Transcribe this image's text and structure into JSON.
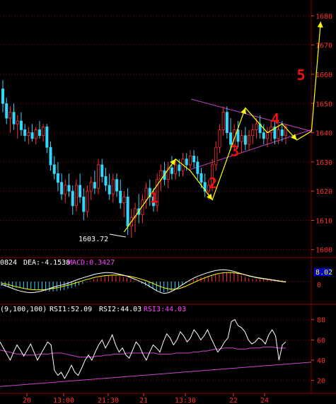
{
  "chart_data": {
    "type": "candlestick",
    "main_panel": {
      "y_ticks": [
        "1680",
        "1670",
        "1660",
        "1650",
        "1640",
        "1630",
        "1620",
        "1610",
        "1600"
      ],
      "ylim": [
        1598,
        1683
      ],
      "grid": true,
      "low_annotation": "1603.72",
      "wave_labels": [
        "1",
        "2",
        "3",
        "4",
        "5"
      ],
      "colors": {
        "up": "#ff3030",
        "down": "#30d8ff",
        "grid": "#8b0000",
        "axis_text": "#ff3030",
        "trend": "#cc44cc",
        "projection": "#ffff00",
        "wave_label": "#ee1111"
      },
      "candles": [
        [
          1655,
          1658,
          1647,
          1650
        ],
        [
          1650,
          1652,
          1643,
          1645
        ],
        [
          1645,
          1649,
          1640,
          1647
        ],
        [
          1647,
          1650,
          1641,
          1643
        ],
        [
          1643,
          1646,
          1638,
          1644
        ],
        [
          1644,
          1647,
          1639,
          1641
        ],
        [
          1641,
          1643,
          1637,
          1639
        ],
        [
          1639,
          1642,
          1636,
          1640
        ],
        [
          1640,
          1643,
          1637,
          1638
        ],
        [
          1638,
          1642,
          1636,
          1641
        ],
        [
          1641,
          1644,
          1638,
          1639
        ],
        [
          1639,
          1643,
          1637,
          1642
        ],
        [
          1642,
          1643,
          1633,
          1635
        ],
        [
          1635,
          1637,
          1627,
          1629
        ],
        [
          1629,
          1632,
          1624,
          1626
        ],
        [
          1626,
          1630,
          1620,
          1623
        ],
        [
          1623,
          1626,
          1617,
          1619
        ],
        [
          1619,
          1624,
          1616,
          1622
        ],
        [
          1622,
          1626,
          1618,
          1620
        ],
        [
          1620,
          1622,
          1612,
          1615
        ],
        [
          1615,
          1624,
          1613,
          1622
        ],
        [
          1622,
          1626,
          1616,
          1618
        ],
        [
          1618,
          1621,
          1610,
          1613
        ],
        [
          1613,
          1622,
          1611,
          1620
        ],
        [
          1620,
          1625,
          1617,
          1623
        ],
        [
          1623,
          1627,
          1619,
          1621
        ],
        [
          1621,
          1631,
          1619,
          1629
        ],
        [
          1629,
          1631,
          1623,
          1625
        ],
        [
          1625,
          1628,
          1620,
          1622
        ],
        [
          1622,
          1626,
          1617,
          1619
        ],
        [
          1619,
          1626,
          1616,
          1624
        ],
        [
          1624,
          1626,
          1618,
          1620
        ],
        [
          1620,
          1624,
          1614,
          1616
        ],
        [
          1616,
          1620,
          1611,
          1618
        ],
        [
          1618,
          1621,
          1605,
          1608
        ],
        [
          1608,
          1614,
          1604,
          1611
        ],
        [
          1611,
          1616,
          1606,
          1614
        ],
        [
          1614,
          1619,
          1609,
          1612
        ],
        [
          1612,
          1619,
          1609,
          1617
        ],
        [
          1617,
          1623,
          1614,
          1621
        ],
        [
          1621,
          1624,
          1615,
          1618
        ],
        [
          1618,
          1621,
          1613,
          1615
        ],
        [
          1615,
          1626,
          1613,
          1624
        ],
        [
          1624,
          1629,
          1620,
          1627
        ],
        [
          1627,
          1630,
          1622,
          1624
        ],
        [
          1624,
          1630,
          1621,
          1628
        ],
        [
          1628,
          1632,
          1624,
          1626
        ],
        [
          1626,
          1631,
          1624,
          1629
        ],
        [
          1629,
          1631,
          1625,
          1627
        ],
        [
          1627,
          1633,
          1625,
          1631
        ],
        [
          1631,
          1633,
          1627,
          1629
        ],
        [
          1629,
          1634,
          1627,
          1632
        ],
        [
          1632,
          1634,
          1628,
          1630
        ],
        [
          1630,
          1632,
          1624,
          1626
        ],
        [
          1626,
          1628,
          1621,
          1623
        ],
        [
          1623,
          1626,
          1618,
          1620
        ],
        [
          1620,
          1624,
          1617,
          1622
        ],
        [
          1622,
          1631,
          1620,
          1629
        ],
        [
          1629,
          1637,
          1627,
          1635
        ],
        [
          1635,
          1643,
          1633,
          1641
        ],
        [
          1641,
          1649,
          1639,
          1647
        ],
        [
          1647,
          1649,
          1638,
          1640
        ],
        [
          1640,
          1645,
          1634,
          1636
        ],
        [
          1636,
          1643,
          1634,
          1641
        ],
        [
          1641,
          1644,
          1635,
          1637
        ],
        [
          1637,
          1641,
          1633,
          1639
        ],
        [
          1639,
          1642,
          1634,
          1636
        ],
        [
          1636,
          1641,
          1634,
          1639
        ],
        [
          1639,
          1643,
          1636,
          1641
        ],
        [
          1641,
          1645,
          1638,
          1643
        ],
        [
          1643,
          1646,
          1638,
          1640
        ],
        [
          1640,
          1643,
          1636,
          1638
        ],
        [
          1638,
          1642,
          1635,
          1640
        ],
        [
          1640,
          1644,
          1637,
          1642
        ],
        [
          1642,
          1644,
          1636,
          1638
        ],
        [
          1638,
          1643,
          1636,
          1641
        ],
        [
          1641,
          1644,
          1637,
          1639
        ],
        [
          1639,
          1643,
          1636,
          1642
        ]
      ]
    },
    "macd_panel": {
      "label_prefix": "0824",
      "dea_label": "DEA:-4.1538",
      "macd_label": "MACD:0.3427",
      "y_ticks": [
        "0"
      ],
      "badge": "8.02",
      "ylim": [
        -7,
        5
      ],
      "histogram": [
        -1.5,
        -1.8,
        -2.0,
        -2.1,
        -2.2,
        -2.3,
        -2.4,
        -2.5,
        -2.6,
        -2.8,
        -3.0,
        -3.2,
        -3.4,
        -3.5,
        -3.5,
        -3.4,
        -3.2,
        -3.0,
        -2.6,
        -2.2,
        -1.8,
        -1.3,
        -0.8,
        -0.2,
        0.3,
        0.8,
        1.2,
        1.6,
        1.9,
        2.1,
        2.2,
        2.2,
        2.0,
        1.7,
        1.3,
        0.9,
        0.4,
        -0.2,
        -0.8,
        -1.4,
        -2.0,
        -2.6,
        -3.2,
        -3.6,
        -3.8,
        -3.6,
        -3.2,
        -2.6,
        -1.9,
        -1.2,
        -0.4,
        0.3,
        0.9,
        1.3,
        1.6,
        1.8,
        2.0,
        2.2,
        2.4,
        2.6,
        2.9,
        3.2,
        3.4,
        3.2,
        2.8,
        2.3,
        1.8,
        1.3,
        1.0,
        0.9,
        0.8,
        0.8,
        0.7,
        0.7,
        0.7,
        0.6,
        0.5,
        0.4
      ],
      "dif": [
        -1.0,
        -1.4,
        -1.9,
        -2.4,
        -2.9,
        -3.3,
        -3.6,
        -3.8,
        -3.9,
        -3.8,
        -3.6,
        -3.3,
        -2.9,
        -2.5,
        -2.0,
        -1.6,
        -1.3,
        -1.0,
        -0.6,
        -0.1,
        0.4,
        0.9,
        1.3,
        1.7,
        2.1,
        2.5,
        2.8,
        3.0,
        3.2,
        3.2,
        3.1,
        2.9,
        2.6,
        2.3,
        1.9,
        1.4,
        0.9,
        0.4,
        -0.2,
        -0.8,
        -1.6,
        -2.4,
        -3.2,
        -3.8,
        -4.2,
        -4.0,
        -3.5,
        -2.8,
        -2.0,
        -1.1,
        -0.3,
        0.5,
        1.2,
        1.8,
        2.3,
        2.8,
        3.2,
        3.6,
        3.9,
        4.1,
        4.2,
        4.1,
        3.9,
        3.6,
        3.2,
        2.8,
        2.4,
        2.0,
        1.7,
        1.4,
        1.2,
        1.0,
        0.8,
        0.6,
        0.4,
        0.2,
        0.0,
        -0.2
      ],
      "dea": [
        -0.5,
        -0.8,
        -1.1,
        -1.5,
        -1.8,
        -2.1,
        -2.4,
        -2.6,
        -2.8,
        -2.9,
        -2.9,
        -2.9,
        -2.8,
        -2.6,
        -2.4,
        -2.2,
        -1.9,
        -1.6,
        -1.3,
        -0.9,
        -0.5,
        -0.1,
        0.3,
        0.7,
        1.0,
        1.4,
        1.7,
        1.9,
        2.1,
        2.2,
        2.3,
        2.3,
        2.3,
        2.2,
        2.0,
        1.8,
        1.5,
        1.2,
        0.8,
        0.4,
        -0.1,
        -0.6,
        -1.2,
        -1.7,
        -2.2,
        -2.5,
        -2.7,
        -2.7,
        -2.5,
        -2.1,
        -1.6,
        -1.0,
        -0.4,
        0.2,
        0.8,
        1.3,
        1.8,
        2.2,
        2.6,
        2.9,
        3.1,
        3.2,
        3.2,
        3.1,
        2.9,
        2.7,
        2.4,
        2.1,
        1.8,
        1.5,
        1.3,
        1.1,
        0.9,
        0.7,
        0.5,
        0.3,
        0.1,
        -0.1
      ],
      "colors": {
        "hist_up": "#ff3030",
        "hist_down": "#30d8ff",
        "dif": "#ffffff",
        "dea": "#ffff00",
        "badge_bg": "#0000cc",
        "badge_text": "#ffff00"
      }
    },
    "rsi_panel": {
      "params_label": "(9,100,100)",
      "rsi1_label": "RSI1:52.09",
      "rsi2_label": "RSI2:44.03",
      "rsi3_label": "RSI3:44.03",
      "y_ticks": [
        "80",
        "60",
        "40",
        "20"
      ],
      "ylim": [
        10,
        84
      ],
      "rsi1": [
        58,
        52,
        46,
        40,
        48,
        55,
        50,
        44,
        50,
        56,
        48,
        40,
        46,
        52,
        58,
        55,
        30,
        25,
        28,
        22,
        28,
        35,
        28,
        25,
        32,
        40,
        45,
        40,
        48,
        55,
        60,
        52,
        58,
        65,
        55,
        48,
        52,
        45,
        42,
        50,
        58,
        54,
        46,
        40,
        48,
        55,
        52,
        48,
        58,
        66,
        62,
        55,
        60,
        68,
        64,
        58,
        62,
        70,
        66,
        60,
        64,
        70,
        62,
        55,
        48,
        52,
        58,
        62,
        78,
        80,
        74,
        72,
        68,
        60,
        56,
        58,
        62,
        60,
        56,
        65,
        70,
        64,
        40,
        55,
        58
      ],
      "rsi2": [
        50,
        49,
        48,
        47,
        46,
        46,
        45,
        45,
        45,
        46,
        46,
        46,
        47,
        47,
        47,
        46,
        45,
        44,
        43,
        43,
        43,
        43,
        44,
        44,
        45,
        45,
        46,
        46,
        46,
        47,
        47,
        47,
        47,
        47,
        47,
        47,
        46,
        46,
        46,
        46,
        47,
        47,
        47,
        47,
        48,
        48,
        49,
        49,
        50,
        51,
        51,
        52,
        52,
        52,
        51,
        51,
        51,
        52,
        52,
        52,
        53,
        53,
        53,
        52,
        52,
        52
      ],
      "baseline_trend": [
        [
          0,
          14
        ],
        [
          1,
          38
        ]
      ],
      "colors": {
        "rsi1": "#ffffff",
        "rsi2": "#cc44cc",
        "rsi3": "#cc44cc",
        "trend": "#cc44cc"
      }
    },
    "x_ticks": [
      "20",
      "13:00",
      "21:30",
      "21",
      "13:30",
      "22",
      "24"
    ]
  }
}
